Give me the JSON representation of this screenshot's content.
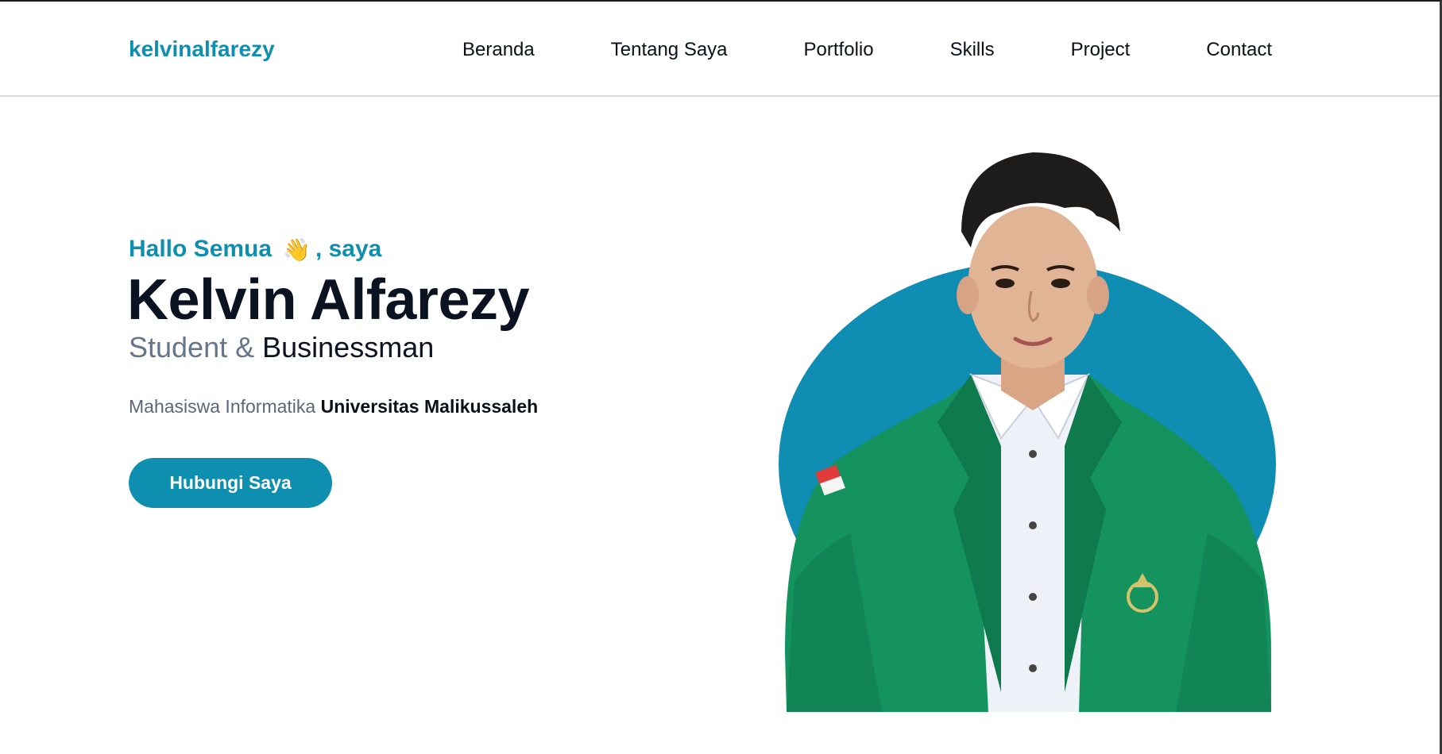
{
  "brand": "kelvinalfarezy",
  "nav": {
    "items": [
      {
        "label": "Beranda"
      },
      {
        "label": "Tentang Saya"
      },
      {
        "label": "Portfolio"
      },
      {
        "label": "Skills"
      },
      {
        "label": "Project"
      },
      {
        "label": "Contact"
      }
    ]
  },
  "hero": {
    "greeting_before": "Hallo Semua",
    "greeting_emoji": "👋",
    "greeting_after": ", saya",
    "name": "Kelvin Alfarezy",
    "role_part1": "Student",
    "role_amp": " & ",
    "role_part2": "Businessman",
    "desc_prefix": "Mahasiswa Informatika ",
    "desc_university": "Universitas Malikussaleh",
    "cta_label": "Hubungi Saya",
    "photo_icon": "profile-photo"
  },
  "colors": {
    "accent": "#0e8fb0",
    "heading": "#0b1221",
    "muted": "#66758a",
    "jacket": "#14935f"
  }
}
